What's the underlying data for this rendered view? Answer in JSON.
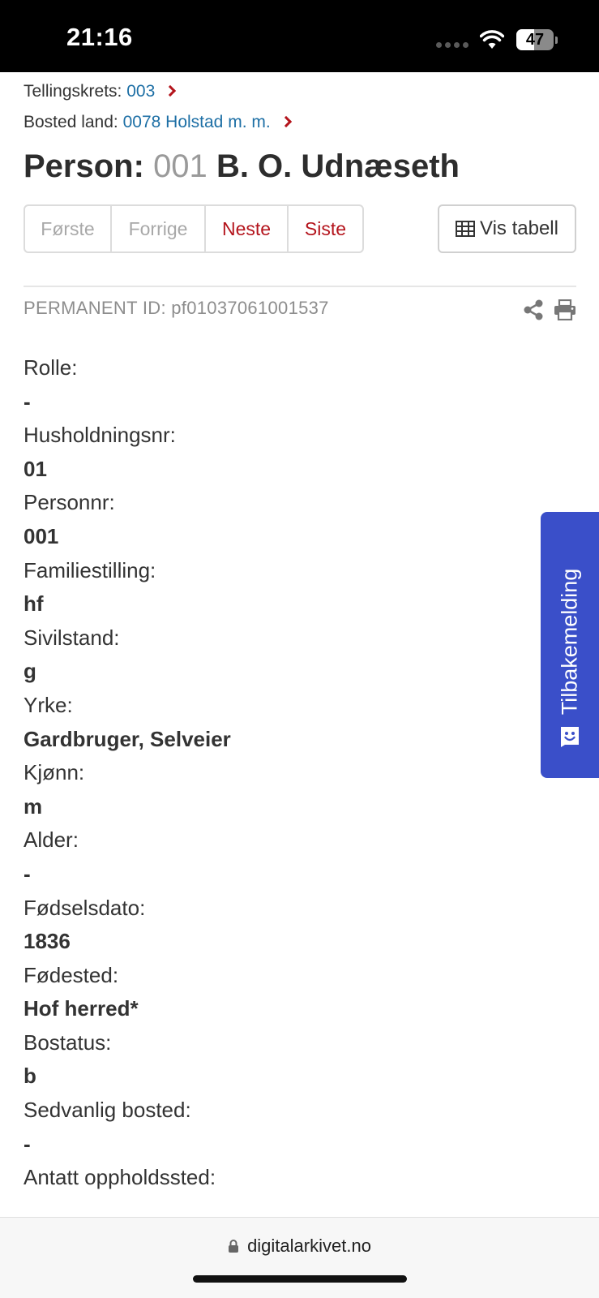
{
  "status_bar": {
    "time": "21:16",
    "battery": "47"
  },
  "breadcrumbs": [
    {
      "label": "Tellingskrets:",
      "link": "003"
    },
    {
      "label": "Bosted land:",
      "link": "0078 Holstad m. m."
    }
  ],
  "title": {
    "prefix": "Person:",
    "number": "001",
    "name": "B. O. Udnæseth"
  },
  "pager": {
    "first": "Første",
    "prev": "Forrige",
    "next": "Neste",
    "last": "Siste"
  },
  "vis_tabell": "Vis tabell",
  "permanent_id": "PERMANENT ID: pf01037061001537",
  "fields": [
    {
      "label": "Rolle:",
      "value": "-"
    },
    {
      "label": "Husholdningsnr:",
      "value": "01"
    },
    {
      "label": "Personnr:",
      "value": "001"
    },
    {
      "label": "Familiestilling:",
      "value": "hf"
    },
    {
      "label": "Sivilstand:",
      "value": "g"
    },
    {
      "label": "Yrke:",
      "value": "Gardbruger, Selveier"
    },
    {
      "label": "Kjønn:",
      "value": "m"
    },
    {
      "label": "Alder:",
      "value": "-"
    },
    {
      "label": "Fødselsdato:",
      "value": "1836"
    },
    {
      "label": "Fødested:",
      "value": "Hof herred*"
    },
    {
      "label": "Bostatus:",
      "value": "b"
    },
    {
      "label": "Sedvanlig bosted:",
      "value": "-"
    },
    {
      "label": "Antatt oppholdssted:",
      "value": ""
    }
  ],
  "feedback": "Tilbakemelding",
  "url": "digitalarkivet.no",
  "colors": {
    "accent_red": "#b4141c",
    "link_blue": "#1d6fa5",
    "feedback_blue": "#3a4fc9"
  },
  "icons": [
    "wifi-icon",
    "battery-icon",
    "chevron-right-icon",
    "table-icon",
    "share-icon",
    "print-icon",
    "smile-icon",
    "lock-icon"
  ]
}
